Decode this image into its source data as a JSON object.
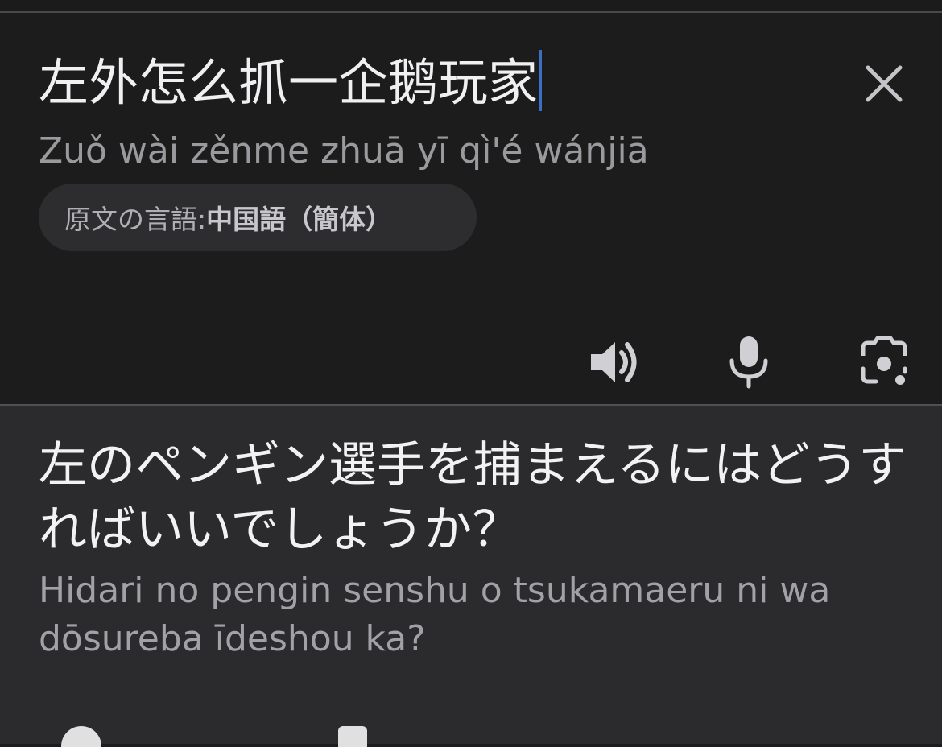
{
  "source": {
    "text": "左外怎么抓一企鹅玩家",
    "romanization": "Zuǒ wài zěnme zhuā yī qì'é wánjiā",
    "language_label": "原文の言語: ",
    "language_name": "中国語（簡体）"
  },
  "translation": {
    "text": "左のペンギン選手を捕まえるにはどうすればいいでしょうか？",
    "romanization": "Hidari no pengin senshu o tsukamaeru ni wa dōsureba īdeshou ka?"
  },
  "icons": {
    "clear": "close-icon",
    "listen": "speaker-icon",
    "voice": "microphone-icon",
    "camera": "camera-icon"
  },
  "colors": {
    "input_background": "#1c1c1c",
    "output_background": "#2b2b2e",
    "caret": "#3a6fc5"
  }
}
